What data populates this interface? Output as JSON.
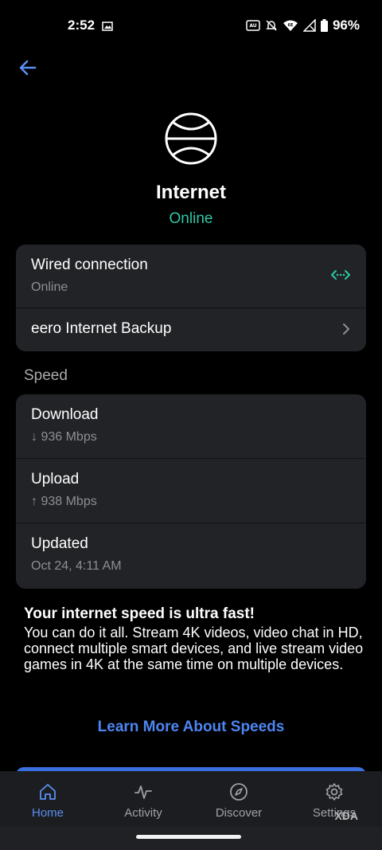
{
  "status_bar": {
    "time": "2:52",
    "battery": "96%"
  },
  "header": {
    "title": "Internet",
    "status": "Online",
    "status_color": "#2fc7a6"
  },
  "connection_card": {
    "wired": {
      "title": "Wired connection",
      "status": "Online"
    },
    "backup": {
      "title": "eero Internet Backup"
    }
  },
  "speed": {
    "section_label": "Speed",
    "rows": [
      {
        "title": "Download",
        "value": "↓ 936 Mbps"
      },
      {
        "title": "Upload",
        "value": "↑ 938 Mbps"
      },
      {
        "title": "Updated",
        "value": "Oct 24, 4:11 AM"
      }
    ]
  },
  "info": {
    "title": "Your internet speed is ultra fast!",
    "body": "You can do it all. Stream 4K videos, video chat in HD, connect multiple smart devices, and live stream video games in 4K at the same time on multiple devices."
  },
  "learn_more": "Learn More About Speeds",
  "bottom_nav": {
    "active": "Home",
    "items": [
      {
        "label": "Home",
        "icon": "home-icon"
      },
      {
        "label": "Activity",
        "icon": "activity-icon"
      },
      {
        "label": "Discover",
        "icon": "compass-icon"
      },
      {
        "label": "Settings",
        "icon": "gear-icon"
      }
    ]
  },
  "watermark": "XDA",
  "colors": {
    "accent": "#5a8ff0",
    "online": "#2fc7a6",
    "card": "#222326"
  }
}
